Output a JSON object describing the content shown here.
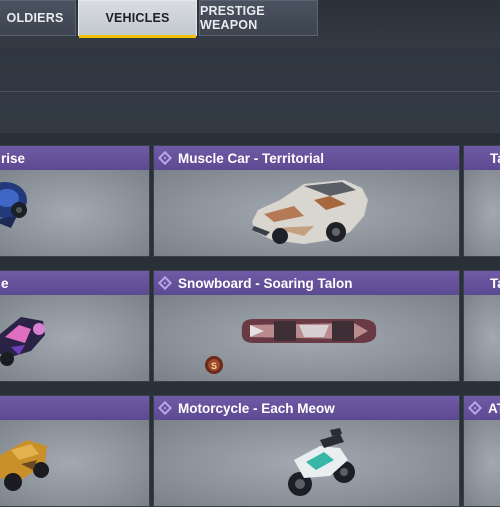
{
  "tabs": [
    {
      "label": "OLDIERS",
      "active": false
    },
    {
      "label": "VEHICLES",
      "active": true
    },
    {
      "label": "PRESTIGE WEAPON",
      "active": false
    }
  ],
  "cards": [
    {
      "title": "rise"
    },
    {
      "title": "Muscle Car - Territorial"
    },
    {
      "title": "Ta"
    },
    {
      "title": "e"
    },
    {
      "title": "Snowboard - Soaring Talon",
      "badge": "S"
    },
    {
      "title": "Ta"
    },
    {
      "title": ""
    },
    {
      "title": "Motorcycle - Each Meow"
    },
    {
      "title": "AT"
    }
  ],
  "colors": {
    "header_purple": "#6a56a0",
    "active_tab_underline": "#f2c200"
  }
}
